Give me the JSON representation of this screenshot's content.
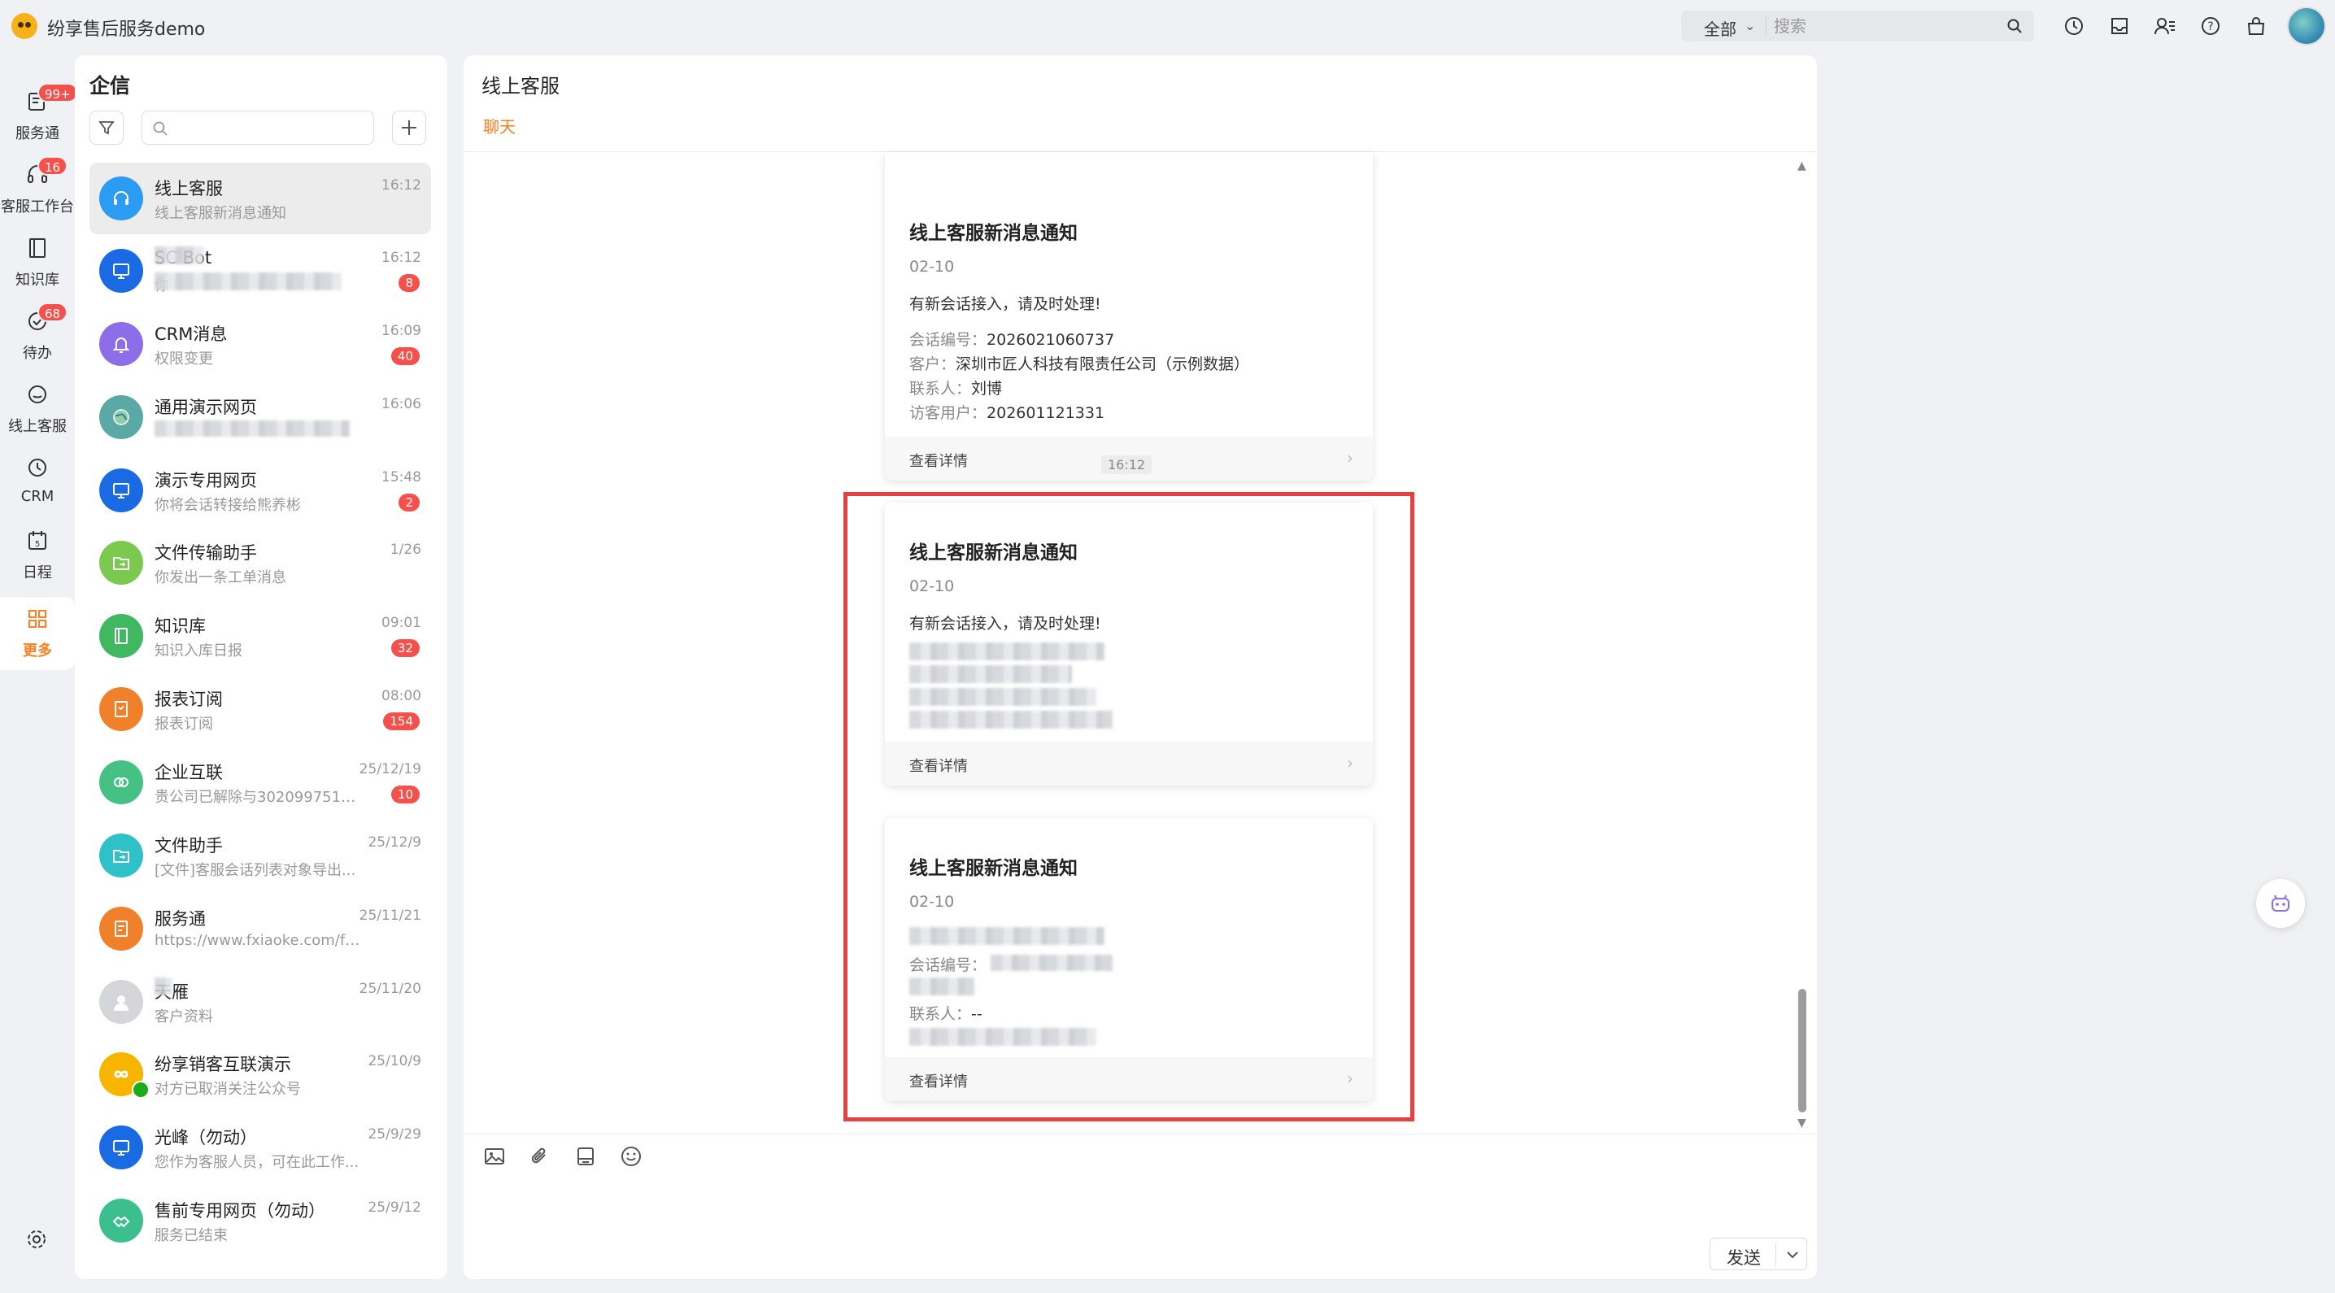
{
  "app": {
    "title": "纷享售后服务demo"
  },
  "topbar": {
    "scope_label": "全部",
    "search_placeholder": "搜索",
    "icons": [
      "clock-icon",
      "inbox-icon",
      "contacts-icon",
      "help-icon",
      "bag-icon"
    ]
  },
  "leftnav": {
    "items": [
      {
        "label": "服务通",
        "icon": "service-icon",
        "badge": "99+"
      },
      {
        "label": "客服工作台",
        "icon": "headset-icon",
        "badge": "16"
      },
      {
        "label": "知识库",
        "icon": "book-icon",
        "badge": ""
      },
      {
        "label": "待办",
        "icon": "check-icon",
        "badge": "68"
      },
      {
        "label": "线上客服",
        "icon": "chat-icon",
        "badge": ""
      },
      {
        "label": "CRM",
        "icon": "clock-icon",
        "badge": ""
      },
      {
        "label": "日程",
        "icon": "calendar-icon",
        "badge": ""
      },
      {
        "label": "更多",
        "icon": "grid-icon",
        "badge": "",
        "active": true
      }
    ]
  },
  "conversations": {
    "title": "企信",
    "items": [
      {
        "name": "线上客服",
        "preview": "线上客服新消息通知",
        "time": "16:12",
        "badge": "",
        "avatar_color": "#2b9cf2",
        "icon": "headset-icon",
        "active": true
      },
      {
        "name": "SC Bot",
        "preview": "你",
        "time": "16:12",
        "badge": "8",
        "avatar_color": "#1a6be3",
        "icon": "monitor-icon"
      },
      {
        "name": "CRM消息",
        "preview": "权限变更",
        "time": "16:09",
        "badge": "40",
        "avatar_color": "#8b6ee8",
        "icon": "bell-icon"
      },
      {
        "name": "通用演示网页",
        "preview": "",
        "time": "16:06",
        "badge": "",
        "avatar_color": "#5aa9a6",
        "icon": "globe-icon"
      },
      {
        "name": "演示专用网页",
        "preview": "你将会话转接给熊养彬",
        "time": "15:48",
        "badge": "2",
        "avatar_color": "#1a6be3",
        "icon": "monitor-icon"
      },
      {
        "name": "文件传输助手",
        "preview": "你发出一条工单消息",
        "time": "1/26",
        "badge": "",
        "avatar_color": "#7bc94e",
        "icon": "folder-icon"
      },
      {
        "name": "知识库",
        "preview": "知识入库日报",
        "time": "09:01",
        "badge": "32",
        "avatar_color": "#3fb860",
        "icon": "book-icon"
      },
      {
        "name": "报表订阅",
        "preview": "报表订阅",
        "time": "08:00",
        "badge": "154",
        "avatar_color": "#f0812a",
        "icon": "report-icon"
      },
      {
        "name": "企业互联",
        "preview": "贵公司已解除与302099751的...",
        "time": "25/12/19",
        "badge": "10",
        "avatar_color": "#45c283",
        "icon": "link-icon"
      },
      {
        "name": "文件助手",
        "preview": "[文件]客服会话列表对象导出...",
        "time": "25/12/9",
        "badge": "",
        "avatar_color": "#2ec1c8",
        "icon": "folder-icon"
      },
      {
        "name": "服务通",
        "preview": "https://www.fxiaoke.com/fsh5...",
        "time": "25/11/21",
        "badge": "",
        "avatar_color": "#f0812a",
        "icon": "service-icon"
      },
      {
        "name": "天雁",
        "preview": "客户资料",
        "time": "25/11/20",
        "badge": "",
        "avatar_color": "#d5d6d9",
        "icon": "person-icon"
      },
      {
        "name": "纷享销客互联演示",
        "preview": "对方已取消关注公众号",
        "time": "25/10/9",
        "badge": "",
        "avatar_color": "#f7b500",
        "icon": "infinity-icon"
      },
      {
        "name": "光峰（勿动）",
        "preview": "您作为客服人员，可在此工作...",
        "time": "25/9/29",
        "badge": "",
        "avatar_color": "#1a6be3",
        "icon": "monitor-icon"
      },
      {
        "name": "售前专用网页（勿动）",
        "preview": "服务已结束",
        "time": "25/9/12",
        "badge": "",
        "avatar_color": "#3cbf8e",
        "icon": "handshake-icon"
      }
    ]
  },
  "chat": {
    "title": "线上客服",
    "tab": "聊天",
    "time_chip": "16:12",
    "cards": [
      {
        "title": "线上客服新消息通知",
        "date": "02-10",
        "body": "有新会话接入，请及时处理!",
        "fields": [
          {
            "label": "会话编号：",
            "value": "2026021060737"
          },
          {
            "label": "客户：",
            "value": "深圳市匠人科技有限责任公司（示例数据）"
          },
          {
            "label": "联系人：",
            "value": "刘博"
          },
          {
            "label": "访客用户：",
            "value": "202601121331"
          }
        ],
        "footer": "查看详情"
      },
      {
        "title": "线上客服新消息通知",
        "date": "02-10",
        "body": "有新会话接入，请及时处理!",
        "fields": [],
        "footer": "查看详情"
      },
      {
        "title": "线上客服新消息通知",
        "date": "02-10",
        "body": "",
        "fields": [
          {
            "label": "会话编号：",
            "value": ""
          },
          {
            "label": "联系人：",
            "value": "--"
          }
        ],
        "footer": "查看详情"
      }
    ],
    "compose": {
      "tools": [
        "image-icon",
        "attachment-icon",
        "quick-reply-icon",
        "emoji-icon"
      ],
      "send_label": "发送"
    }
  },
  "colors": {
    "accent": "#ff7f1e",
    "badge": "#f5504b",
    "highlight": "#e8403e"
  }
}
